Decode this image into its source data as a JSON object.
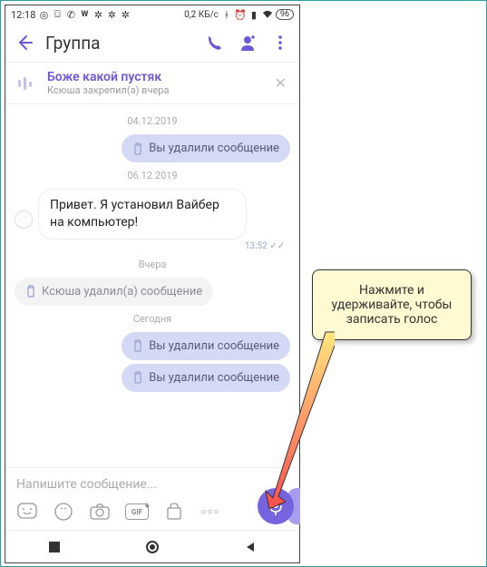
{
  "status": {
    "time": "12:18",
    "data": "0,2 КБ/с",
    "battery": "96"
  },
  "header": {
    "title": "Группа"
  },
  "pinned": {
    "title": "Боже какой пустяк",
    "subtitle": "Ксюша закрепил(а) вчера"
  },
  "dates": {
    "d1": "04.12.2019",
    "d2": "06.12.2019",
    "d3": "Вчера",
    "d4": "Сегодня"
  },
  "messages": {
    "deleted_you": "Вы удалили сообщение",
    "incoming_text": "Привет. Я установил Вайбер на компьютер!",
    "incoming_time": "13:52",
    "deleted_other": "Ксюша удалил(а) сообщение"
  },
  "input": {
    "placeholder": "Напишите сообщение...",
    "gif_label": "GIF",
    "more": "○○○"
  },
  "callout": {
    "text": "Нажмите и удерживайте, чтобы записать голос"
  }
}
